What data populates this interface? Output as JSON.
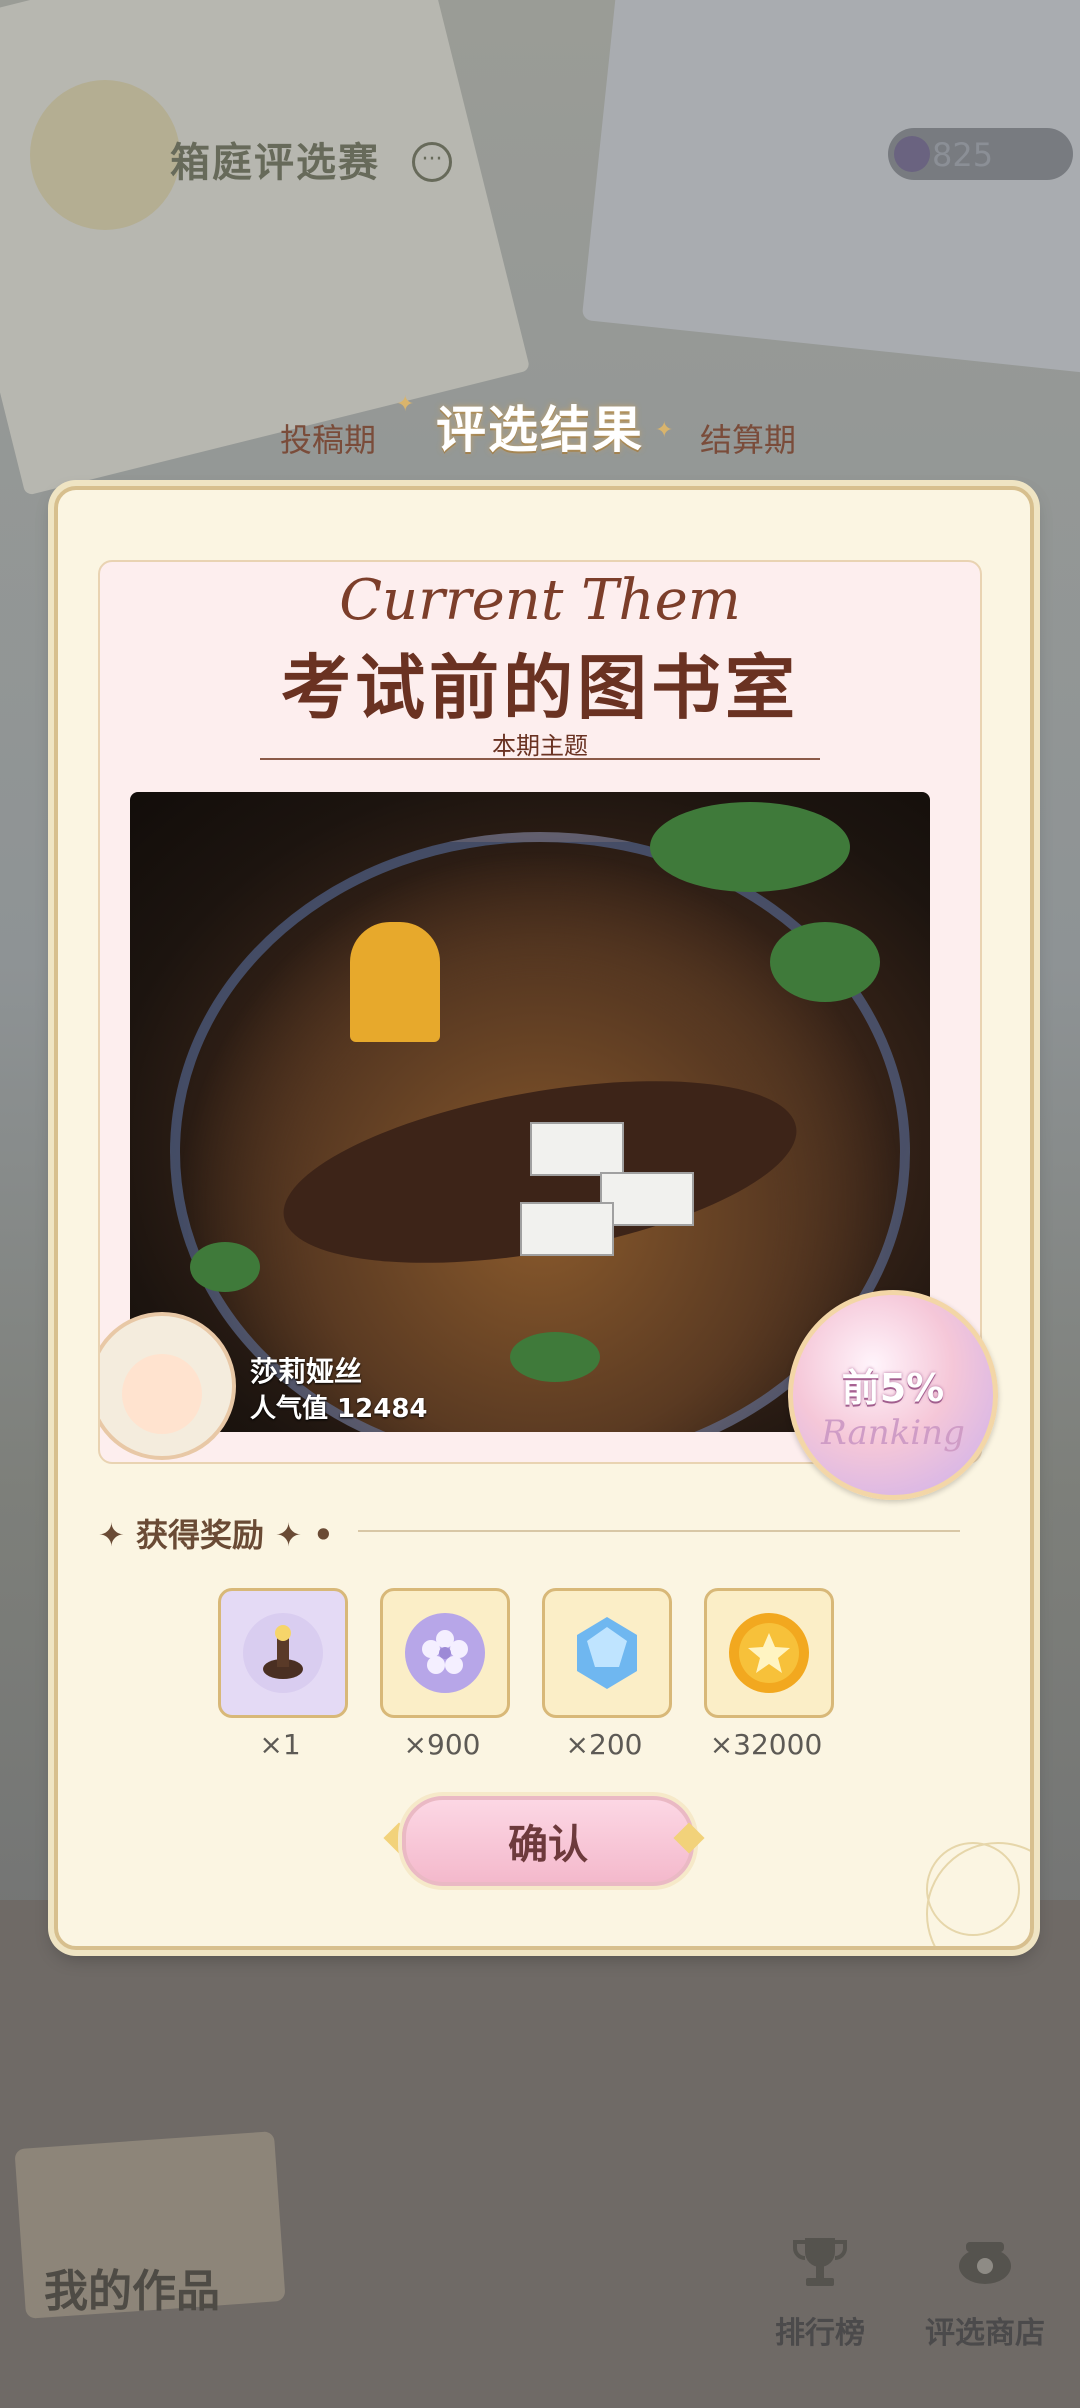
{
  "header": {
    "title": "箱庭评选赛",
    "currency_value": "825"
  },
  "stages": {
    "left": "投稿期",
    "right": "结算期"
  },
  "modal": {
    "title": "评选结果",
    "theme_script": "Current Them",
    "theme_title": "考试前的图书室",
    "theme_subtitle": "本期主题",
    "author": {
      "name": "莎莉娅丝",
      "popularity": "人气值 12484"
    },
    "rank": {
      "label": "前5%",
      "script": "Ranking"
    },
    "rewards_heading": "获得奖励",
    "rewards": [
      {
        "icon": "furniture-icon",
        "qty": "×1",
        "color": "#d9cdf0"
      },
      {
        "icon": "flower-coin-icon",
        "qty": "×900",
        "color": "#b7a6e8"
      },
      {
        "icon": "crystal-icon",
        "qty": "×200",
        "color": "#6fb7f0"
      },
      {
        "icon": "gold-star-coin-icon",
        "qty": "×32000",
        "color": "#f2a81f"
      }
    ],
    "confirm_label": "确认"
  },
  "bottom_nav": {
    "my_works": "我的作品",
    "ranking": "排行榜",
    "shop": "评选商店"
  }
}
